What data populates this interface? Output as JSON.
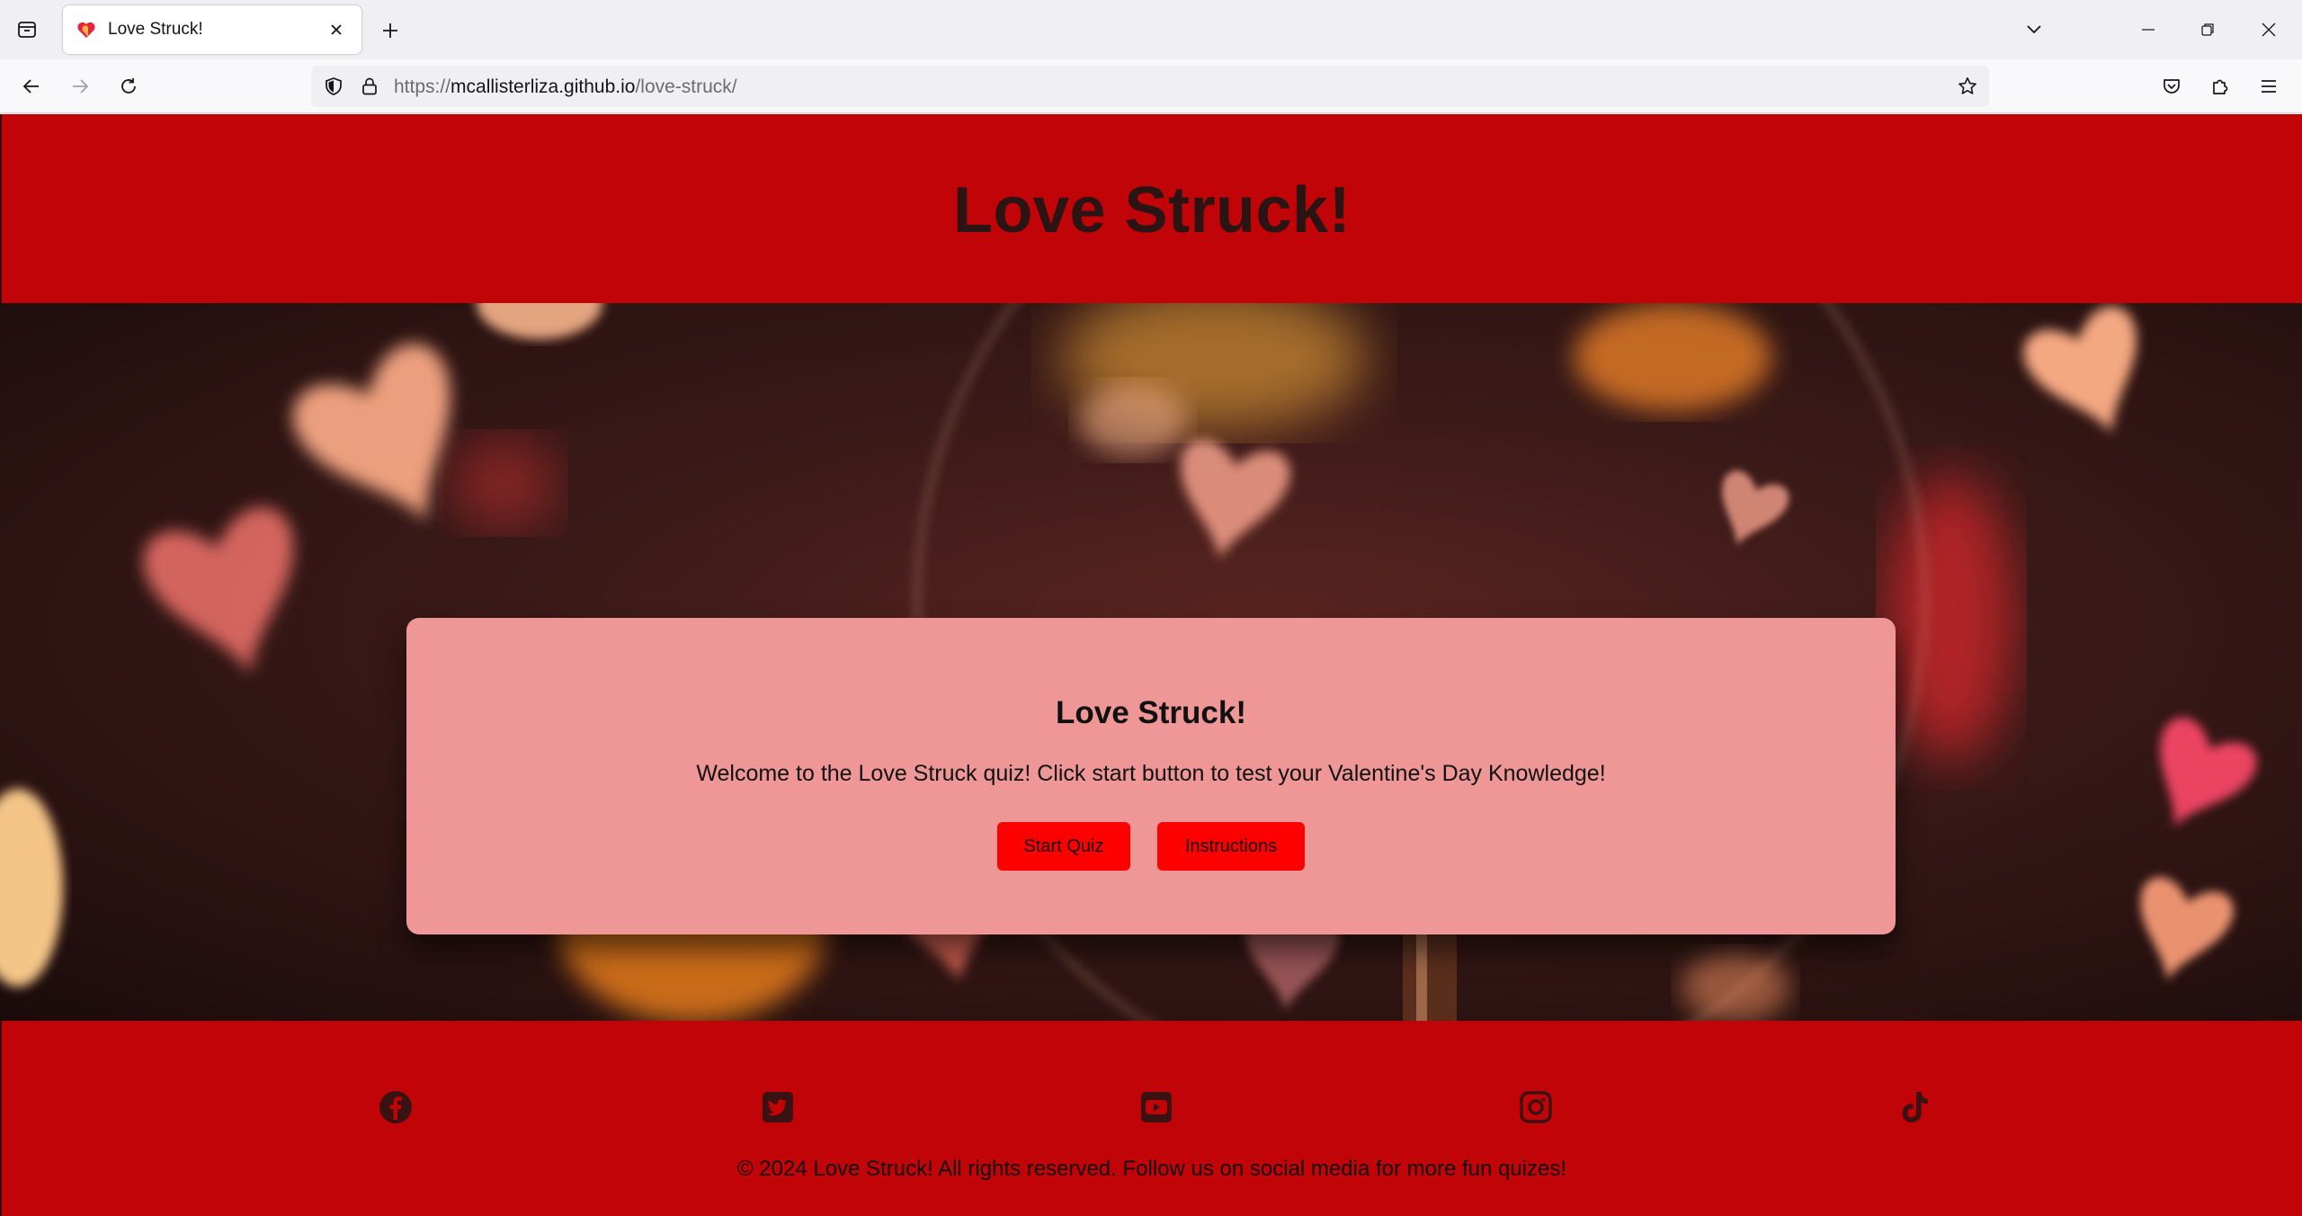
{
  "browser": {
    "tab_title": "Love Struck!",
    "url_prefix": "https://",
    "url_domain": "mcallisterliza.github.io",
    "url_path": "/love-struck/",
    "icons": [
      "tab-list-icon",
      "heart-favicon-icon",
      "close-icon",
      "plus-icon",
      "chevron-down-icon",
      "minimize-icon",
      "restore-icon",
      "close-window-icon",
      "back-arrow-icon",
      "forward-arrow-icon",
      "reload-icon",
      "shield-icon",
      "lock-icon",
      "star-icon",
      "pocket-icon",
      "extensions-icon",
      "menu-icon"
    ]
  },
  "header": {
    "title": "Love Struck!"
  },
  "card": {
    "title": "Love Struck!",
    "text": "Welcome to the Love Struck quiz! Click start button to test your Valentine's Day Knowledge!",
    "start_label": "Start Quiz",
    "instructions_label": "Instructions"
  },
  "footer": {
    "social_icons": [
      "facebook-icon",
      "twitter-icon",
      "youtube-icon",
      "instagram-icon",
      "tiktok-icon"
    ],
    "copyright": "© 2024 Love Struck! All rights reserved. Follow us on social media for more fun quizes!"
  },
  "colors": {
    "brand_red": "#c00408",
    "card_pink": "#ef9696",
    "button_red": "#ff0000"
  }
}
